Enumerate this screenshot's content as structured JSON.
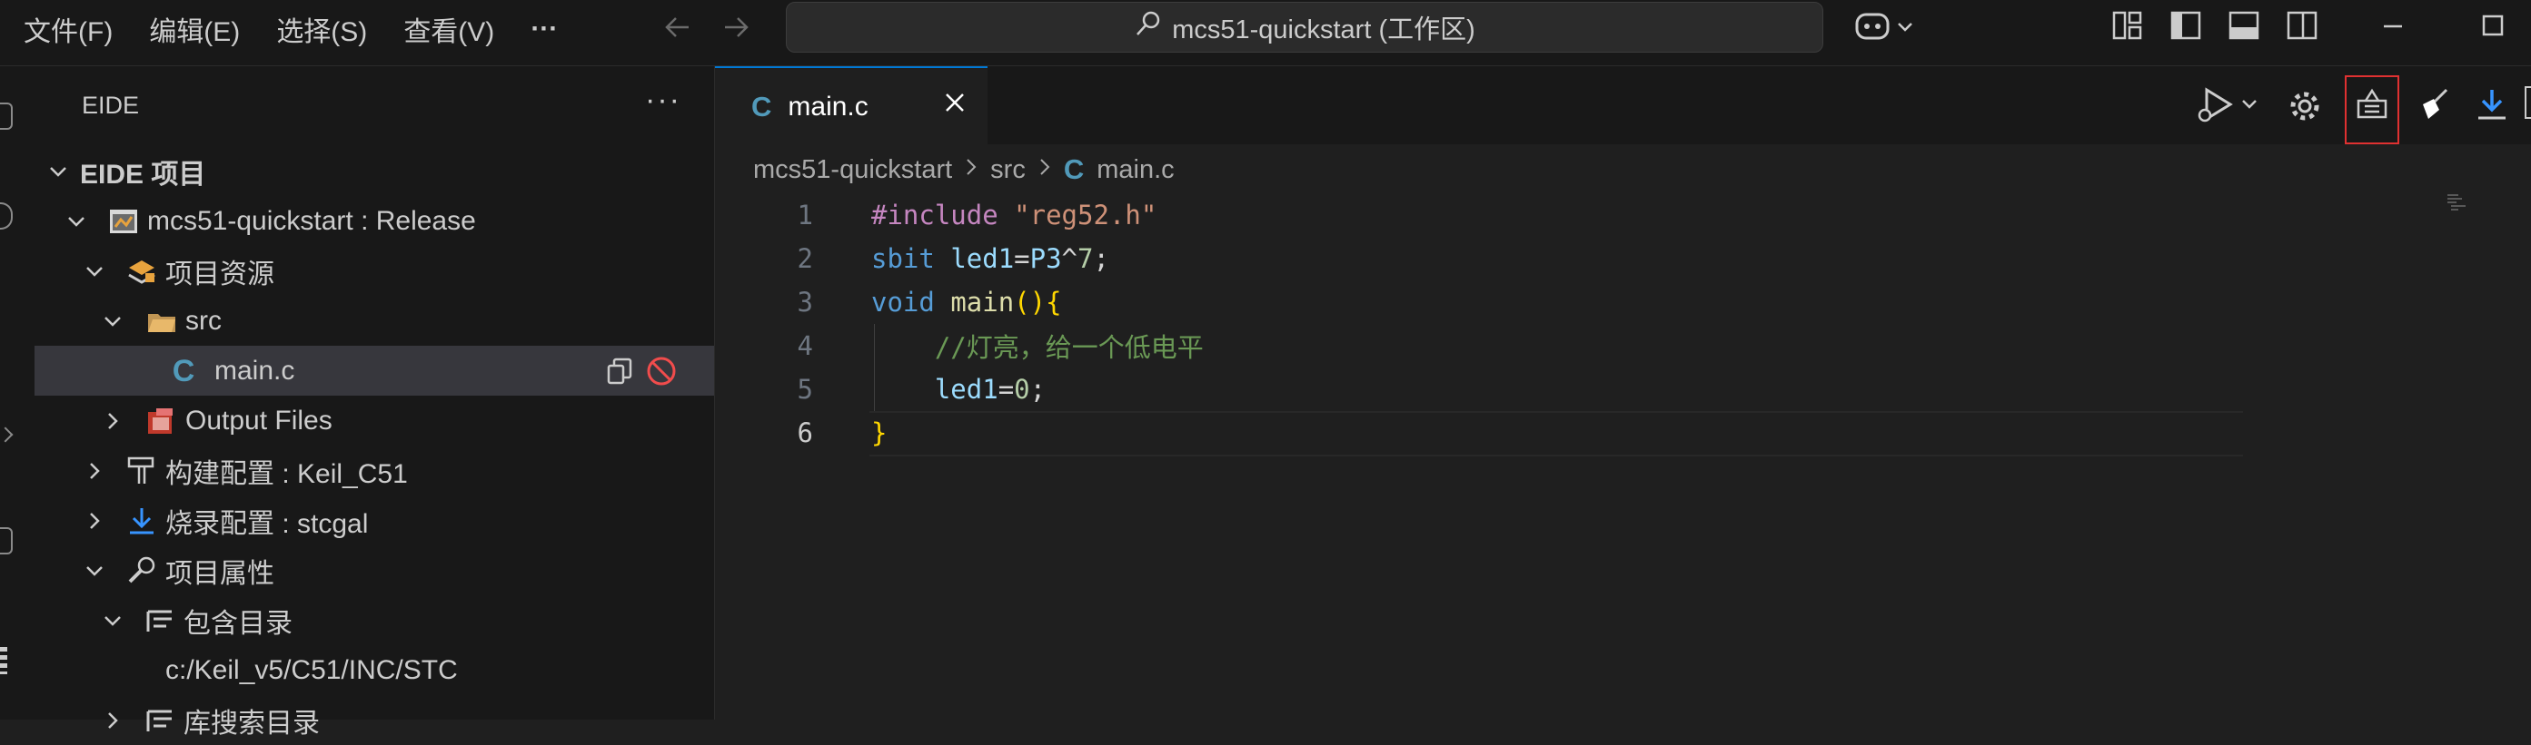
{
  "menubar": {
    "items": [
      "文件(F)",
      "编辑(E)",
      "选择(S)",
      "查看(V)"
    ],
    "more": "···"
  },
  "search": {
    "text": "mcs51-quickstart (工作区)"
  },
  "sidebar": {
    "title": "EIDE",
    "more": "···",
    "tree": [
      {
        "label": "EIDE 项目",
        "level": 0,
        "expanded": true,
        "bold": true,
        "icon": "none"
      },
      {
        "label": "mcs51-quickstart : Release",
        "level": 1,
        "expanded": true,
        "icon": "project-icon"
      },
      {
        "label": "项目资源",
        "level": 2,
        "expanded": true,
        "icon": "resources-icon"
      },
      {
        "label": "src",
        "level": 3,
        "expanded": true,
        "icon": "folder-icon"
      },
      {
        "label": "main.c",
        "level": 4,
        "expanded": null,
        "icon": "c-file-icon",
        "selected": true
      },
      {
        "label": "Output Files",
        "level": 3,
        "expanded": false,
        "icon": "output-files-icon"
      },
      {
        "label": "构建配置 : Keil_C51",
        "level": 2,
        "expanded": false,
        "icon": "build-config-icon"
      },
      {
        "label": "烧录配置 : stcgal",
        "level": 2,
        "expanded": false,
        "icon": "flash-config-icon"
      },
      {
        "label": "项目属性",
        "level": 2,
        "expanded": true,
        "icon": "wrench-icon"
      },
      {
        "label": "包含目录",
        "level": 3,
        "expanded": true,
        "icon": "include-dir-icon"
      },
      {
        "label": "c:/Keil_v5/C51/INC/STC",
        "level": 4,
        "expanded": null,
        "icon": "none"
      },
      {
        "label": "库搜索目录",
        "level": 3,
        "expanded": false,
        "icon": "include-dir-icon"
      }
    ]
  },
  "editor": {
    "tab": {
      "icon": "C",
      "label": "main.c",
      "close": "✕"
    },
    "breadcrumb": [
      "mcs51-quickstart",
      "src",
      "main.c"
    ],
    "lines": [
      {
        "no": "1",
        "tokens": [
          [
            "kw",
            "#include"
          ],
          [
            "plain",
            " "
          ],
          [
            "str",
            "\"reg52.h\""
          ]
        ]
      },
      {
        "no": "2",
        "tokens": [
          [
            "type",
            "sbit"
          ],
          [
            "plain",
            " "
          ],
          [
            "var",
            "led1"
          ],
          [
            "plain",
            "="
          ],
          [
            "var",
            "P3"
          ],
          [
            "plain",
            "^"
          ],
          [
            "num",
            "7"
          ],
          [
            "plain",
            ";"
          ]
        ]
      },
      {
        "no": "3",
        "tokens": [
          [
            "type",
            "void"
          ],
          [
            "plain",
            " "
          ],
          [
            "fn",
            "main"
          ],
          [
            "br",
            "()"
          ],
          [
            "br",
            "{"
          ]
        ]
      },
      {
        "no": "4",
        "tokens": [
          [
            "plain",
            "    "
          ],
          [
            "cmt",
            "//灯亮，给一个低电平"
          ]
        ]
      },
      {
        "no": "5",
        "tokens": [
          [
            "plain",
            "    "
          ],
          [
            "var",
            "led1"
          ],
          [
            "plain",
            "="
          ],
          [
            "num",
            "0"
          ],
          [
            "plain",
            ";"
          ]
        ]
      },
      {
        "no": "6",
        "tokens": [
          [
            "br",
            "}"
          ]
        ]
      }
    ],
    "current_line": 6
  },
  "colors": {
    "accent": "#0078d4",
    "highlight_box": "#e03131",
    "stop_icon": "#f14c4c"
  }
}
